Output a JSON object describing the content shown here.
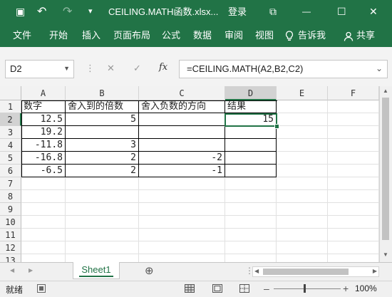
{
  "title_bar": {
    "file_title": "CEILING.MATH函数.xlsx...",
    "login_label": "登录",
    "save_glyph": "▣",
    "undo_glyph": "↶",
    "redo_glyph": "↷",
    "qat_glyph": "▾",
    "restore_glyph": "⧉",
    "minimize_glyph": "—",
    "maximize_glyph": "☐",
    "close_glyph": "✕"
  },
  "ribbon": {
    "tabs": [
      "文件",
      "开始",
      "插入",
      "页面布局",
      "公式",
      "数据",
      "审阅",
      "视图"
    ],
    "tell_me": "告诉我",
    "share": "共享"
  },
  "formula_bar": {
    "name_box": "D2",
    "formula": "=CEILING.MATH(A2,B2,C2)",
    "cancel_glyph": "✕",
    "enter_glyph": "✓",
    "fx": "fx"
  },
  "sheet": {
    "columns": [
      "A",
      "B",
      "C",
      "D",
      "E",
      "F"
    ],
    "rows": [
      "1",
      "2",
      "3",
      "4",
      "5",
      "6",
      "7",
      "8",
      "9",
      "10",
      "11",
      "12",
      "13"
    ],
    "cells": [
      [
        "数字",
        "舍入到的倍数",
        "舍入负数的方向",
        "结果",
        "",
        ""
      ],
      [
        "12.5",
        "5",
        "",
        "15",
        "",
        ""
      ],
      [
        "19.2",
        "",
        "",
        "",
        "",
        ""
      ],
      [
        "-11.8",
        "3",
        "",
        "",
        "",
        ""
      ],
      [
        "-16.8",
        "2",
        "-2",
        "",
        "",
        ""
      ],
      [
        "-6.5",
        "2",
        "-1",
        "",
        "",
        ""
      ]
    ],
    "selected_cell": "D2"
  },
  "tabs": {
    "sheet_name": "Sheet1",
    "add_glyph": "⊕"
  },
  "status": {
    "ready": "就绪",
    "zoom": "100%",
    "minus": "–",
    "plus": "+"
  },
  "colors": {
    "accent": "#217346",
    "selection": "#217346"
  }
}
